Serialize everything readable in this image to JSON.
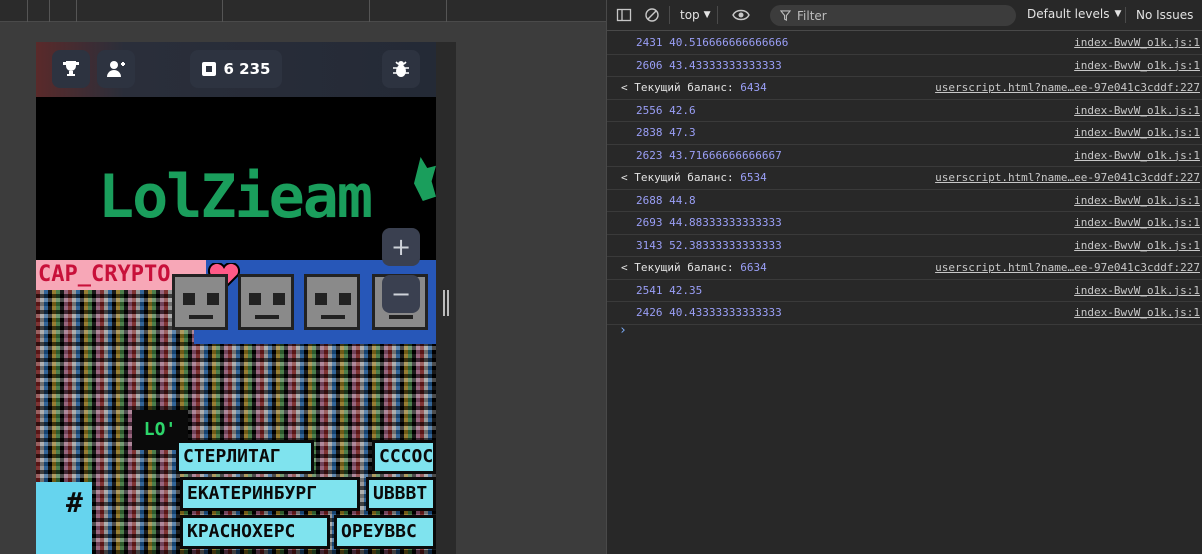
{
  "game": {
    "balance": "6 235",
    "zoom_in": "+",
    "zoom_out": "−",
    "logo_text": "LolZieam",
    "banner_text": "CAP_CRYPTO",
    "lo_text": "LO'",
    "sign_1": "СТЕРЛИТАГ",
    "sign_2": "СССОС",
    "sign_3": "ЕКАТЕРИНБУРГ",
    "sign_4": "UBBBT",
    "sign_5": "КРАСНОХЕРС",
    "sign_6": "ОРЕУВВС",
    "hash": "#"
  },
  "devtools": {
    "context": "top",
    "filter_placeholder": "Filter",
    "levels": "Default levels",
    "issues": "No Issues",
    "logs": [
      {
        "type": "log",
        "text": "2431 40.516666666666666",
        "source": "index-BwvW_o1k.js:1"
      },
      {
        "type": "log",
        "text": "2606 43.43333333333333",
        "source": "index-BwvW_o1k.js:1"
      },
      {
        "type": "result",
        "label": "Текущий баланс: ",
        "value": "6434",
        "source": "userscript.html?name…ee-97e041c3cddf:227"
      },
      {
        "type": "log",
        "text": "2556 42.6",
        "source": "index-BwvW_o1k.js:1"
      },
      {
        "type": "log",
        "text": "2838 47.3",
        "source": "index-BwvW_o1k.js:1"
      },
      {
        "type": "log",
        "text": "2623 43.71666666666667",
        "source": "index-BwvW_o1k.js:1"
      },
      {
        "type": "result",
        "label": "Текущий баланс: ",
        "value": "6534",
        "source": "userscript.html?name…ee-97e041c3cddf:227"
      },
      {
        "type": "log",
        "text": "2688 44.8",
        "source": "index-BwvW_o1k.js:1"
      },
      {
        "type": "log",
        "text": "2693 44.88333333333333",
        "source": "index-BwvW_o1k.js:1"
      },
      {
        "type": "log",
        "text": "3143 52.38333333333333",
        "source": "index-BwvW_o1k.js:1"
      },
      {
        "type": "result",
        "label": "Текущий баланс: ",
        "value": "6634",
        "source": "userscript.html?name…ee-97e041c3cddf:227"
      },
      {
        "type": "log",
        "text": "2541 42.35",
        "source": "index-BwvW_o1k.js:1"
      },
      {
        "type": "log",
        "text": "2426 40.43333333333333",
        "source": "index-BwvW_o1k.js:1"
      }
    ],
    "prompt": "›"
  },
  "colors": {
    "accent": "#7cacf8",
    "log_text": "#9a9ff7",
    "logo_green": "#1a9e5c"
  }
}
